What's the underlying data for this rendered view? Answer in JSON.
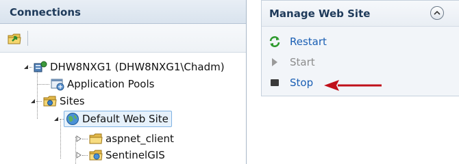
{
  "connections": {
    "title": "Connections",
    "tree": [
      {
        "label": "DHW8NXG1 (DHW8NXG1\\Chadm)",
        "icon": "server-icon"
      },
      {
        "label": "Application Pools",
        "icon": "app-pools-icon"
      },
      {
        "label": "Sites",
        "icon": "sites-folder-icon"
      },
      {
        "label": "Default Web Site",
        "icon": "website-globe-icon",
        "selected": true
      },
      {
        "label": "aspnet_client",
        "icon": "folder-icon"
      },
      {
        "label": "SentinelGIS",
        "icon": "application-icon"
      }
    ]
  },
  "manage_web_site": {
    "title": "Manage Web Site",
    "actions": [
      {
        "label": "Restart",
        "icon": "restart-icon",
        "enabled": true
      },
      {
        "label": "Start",
        "icon": "start-icon",
        "enabled": false
      },
      {
        "label": "Stop",
        "icon": "stop-icon",
        "enabled": true
      }
    ]
  },
  "colors": {
    "link": "#1a5fb4",
    "disabled": "#8c8c8c",
    "annotation_arrow": "#c0101a",
    "header_text": "#1e3a5a"
  }
}
